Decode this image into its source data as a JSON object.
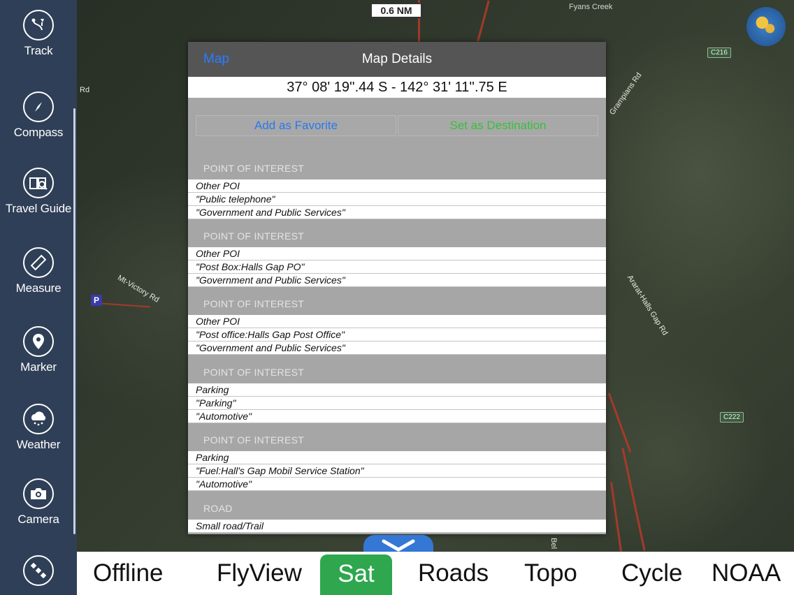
{
  "map": {
    "scale": "0.6 NM",
    "labels": {
      "fyans_creek": "Fyans Creek",
      "rd_left": "Rd",
      "mt_victory": "Mt-Victory Rd",
      "grampians": "Grampians Rd",
      "ararat_halls": "Ararat-Halls Gap Rd",
      "bel": "Bel",
      "c216": "C216",
      "c222": "C222",
      "parking_marker": "P"
    }
  },
  "sidebar": {
    "items": [
      {
        "label": "Track",
        "icon": "track-icon"
      },
      {
        "label": "Compass",
        "icon": "compass-icon"
      },
      {
        "label": "Travel Guide",
        "icon": "travel-guide-icon"
      },
      {
        "label": "Measure",
        "icon": "ruler-icon"
      },
      {
        "label": "Marker",
        "icon": "marker-pin-icon"
      },
      {
        "label": "Weather",
        "icon": "weather-cloud-icon"
      },
      {
        "label": "Camera",
        "icon": "camera-icon"
      },
      {
        "label": "",
        "icon": "satellite-icon"
      }
    ]
  },
  "bottombar": {
    "items": [
      "Offline",
      "FlyView",
      "Sat",
      "Roads",
      "Topo",
      "Cycle",
      "NOAA"
    ],
    "active": "Sat",
    "accent": "#2ea74f"
  },
  "dialog": {
    "back_label": "Map",
    "title": "Map Details",
    "coordinates": "37° 08' 19''.44 S  -  142° 31' 11''.75 E",
    "favorite_label": "Add as Favorite",
    "destination_label": "Set as Destination",
    "sections": [
      {
        "header": "POINT OF INTEREST",
        "rows": [
          "Other POI",
          "\"Public telephone\"",
          "\"Government and Public Services\""
        ]
      },
      {
        "header": "POINT OF INTEREST",
        "rows": [
          "Other POI",
          "\"Post Box:Halls Gap PO\"",
          "\"Government and Public Services\""
        ]
      },
      {
        "header": "POINT OF INTEREST",
        "rows": [
          "Other POI",
          "\"Post office:Halls Gap Post Office\"",
          "\"Government and Public Services\""
        ]
      },
      {
        "header": "POINT OF INTEREST",
        "rows": [
          "Parking",
          "\"Parking\"",
          "\"Automotive\""
        ]
      },
      {
        "header": "POINT OF INTEREST",
        "rows": [
          "Parking",
          "\"Fuel:Hall's Gap Mobil Service Station\"",
          "\"Automotive\""
        ]
      },
      {
        "header": "ROAD",
        "rows": [
          "Small road/Trail"
        ]
      }
    ]
  },
  "colors": {
    "sidebar": "#2f3f57",
    "link_blue": "#2a78f0",
    "destination_green": "#35c13b",
    "chevron_tab": "#3577d4"
  }
}
